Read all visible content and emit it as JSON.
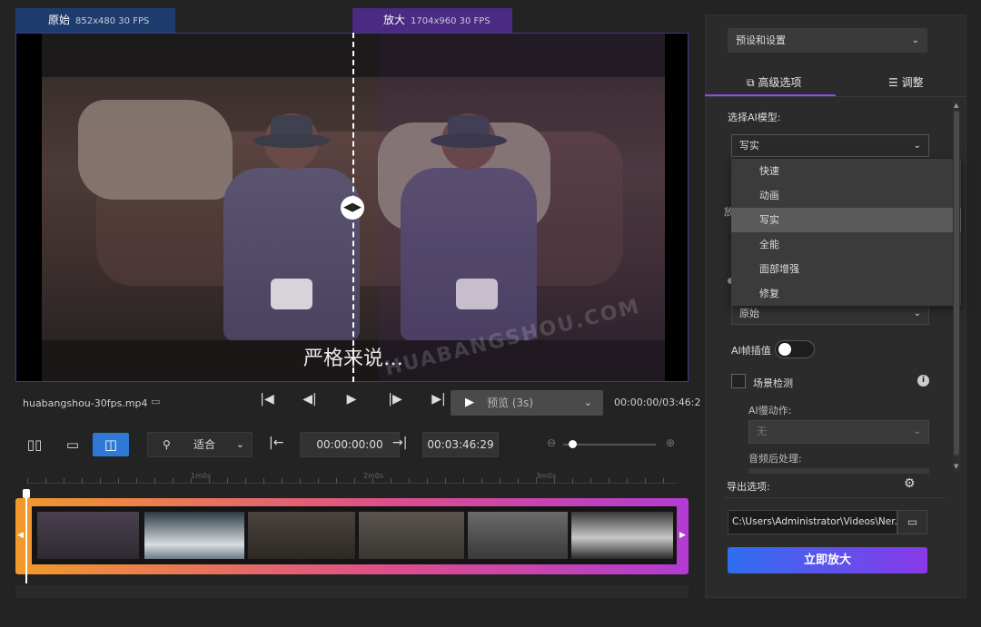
{
  "header": {
    "original_label": "原始",
    "original_meta": "852x480 30 FPS",
    "zoom_label": "放大",
    "zoom_meta": "1704x960 30 FPS"
  },
  "video": {
    "subtitle": "严格来说…",
    "split_handle_glyph": "◀▶",
    "watermark": "HUABANGSHOU.COM"
  },
  "playback": {
    "filename": "huabangshou-30fps.mp4",
    "preview_label": "预览 (3s)",
    "timecode": "00:00:00/03:46:2"
  },
  "toolbar": {
    "fit_label": "适合",
    "start_time": "00:00:00:00",
    "end_time": "00:03:46:29"
  },
  "timeline": {
    "ruler_labels": [
      "1m0s",
      "2m0s",
      "3m0s"
    ]
  },
  "panel": {
    "preset_label": "预设和设置",
    "tab_advanced": "高级选项",
    "tab_adjust": "调整",
    "select_model_label": "选择AI模型:",
    "model_value": "写实",
    "model_options": [
      "快速",
      "动画",
      "写实",
      "全能",
      "面部增强",
      "修复"
    ],
    "model_selected_index": 2,
    "hidden_label": "放",
    "resolution_value": "原始",
    "frame_interp_label": "AI帧插值",
    "frame_interp_on": false,
    "scene_detect_label": "场景检测",
    "scene_detect_checked": false,
    "ai_action_label": "AI慢动作:",
    "ai_action_value": "无",
    "audio_post_label": "音频后处理:",
    "export_label": "导出选项:",
    "export_path": "C:\\Users\\Administrator\\Videos\\Ner...",
    "go_button": "立即放大"
  },
  "colors": {
    "accent_blue": "#2f79d6",
    "accent_purple": "#8a4ee6",
    "strip_gradient_start": "#f19a2a",
    "strip_gradient_end": "#b23bd3"
  }
}
